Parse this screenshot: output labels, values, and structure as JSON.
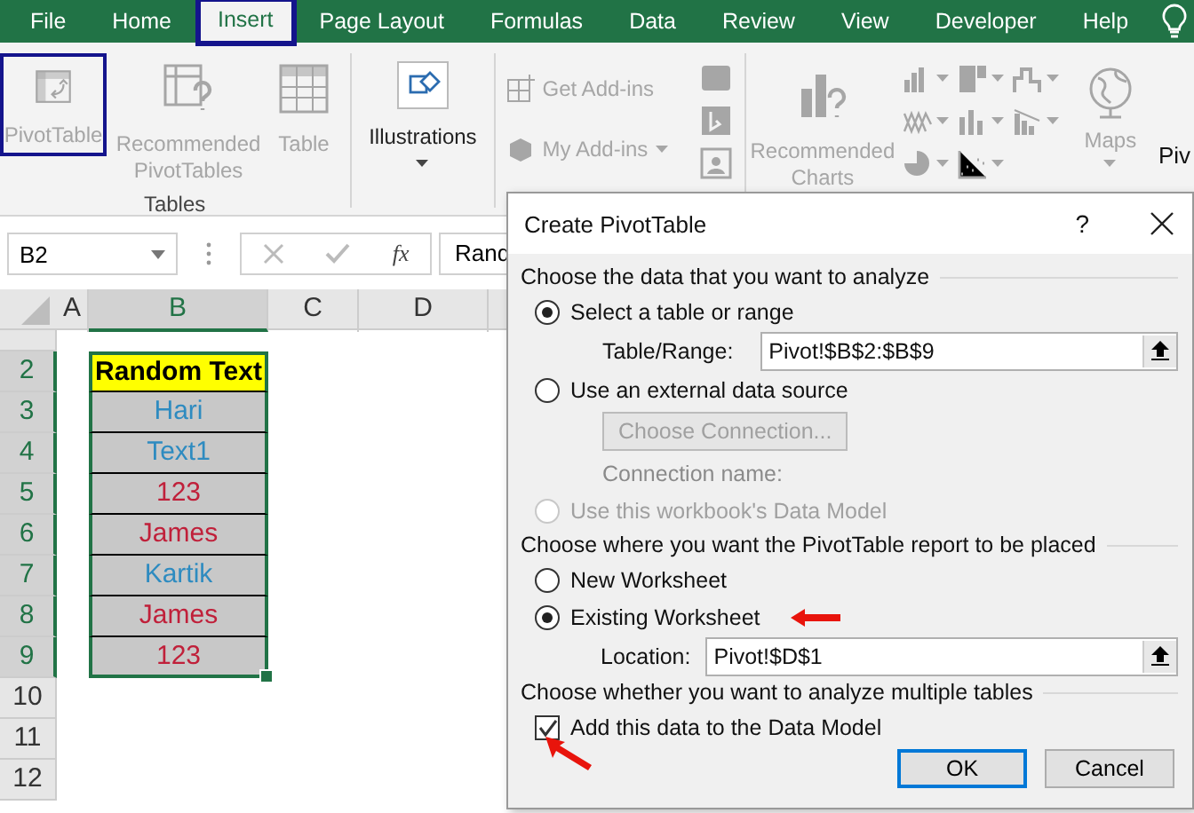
{
  "ribbon_tabs": [
    {
      "label": "File",
      "selected": false,
      "highlighted": false
    },
    {
      "label": "Home",
      "selected": false,
      "highlighted": false
    },
    {
      "label": "Insert",
      "selected": true,
      "highlighted": true
    },
    {
      "label": "Page Layout",
      "selected": false,
      "highlighted": false
    },
    {
      "label": "Formulas",
      "selected": false,
      "highlighted": false
    },
    {
      "label": "Data",
      "selected": false,
      "highlighted": false
    },
    {
      "label": "Review",
      "selected": false,
      "highlighted": false
    },
    {
      "label": "View",
      "selected": false,
      "highlighted": false
    },
    {
      "label": "Developer",
      "selected": false,
      "highlighted": false
    },
    {
      "label": "Help",
      "selected": false,
      "highlighted": false
    }
  ],
  "ribbon": {
    "groups": [
      {
        "label": "Tables",
        "items": [
          {
            "kind": "large",
            "label": "PivotTable",
            "disabled": true,
            "highlighted": true
          },
          {
            "kind": "large",
            "label": "Recommended PivotTables",
            "disabled": true,
            "highlighted": false
          },
          {
            "kind": "large",
            "label": "Table",
            "disabled": true,
            "highlighted": false
          }
        ]
      },
      {
        "items": [
          {
            "kind": "dropdown",
            "label": "Illustrations",
            "disabled": false,
            "highlighted": false
          }
        ]
      },
      {
        "items": [
          {
            "kind": "small",
            "label": "Get Add-ins",
            "disabled": true,
            "highlighted": false
          },
          {
            "kind": "small",
            "label": "My Add-ins",
            "disabled": true,
            "highlighted": false
          },
          {
            "kind": "icons",
            "disabled": true
          }
        ]
      },
      {
        "items": [
          {
            "kind": "large",
            "label": "Recommended Charts",
            "disabled": true,
            "highlighted": false
          },
          {
            "kind": "gallery",
            "disabled": true
          },
          {
            "kind": "dropdown",
            "label": "Maps",
            "disabled": true,
            "highlighted": false
          },
          {
            "kind": "cut",
            "label": "Piv",
            "disabled": false,
            "highlighted": false
          }
        ]
      }
    ]
  },
  "formula_bar": {
    "name_box": "B2",
    "function_label": "fx",
    "formula": "Rand"
  },
  "sheet": {
    "columns": [
      {
        "label": "A",
        "selected": false
      },
      {
        "label": "B",
        "selected": true
      },
      {
        "label": "C",
        "selected": false
      },
      {
        "label": "D",
        "selected": false
      }
    ],
    "rows": [
      {
        "number": "",
        "selected": false,
        "cells": []
      },
      {
        "number": "2",
        "selected": true,
        "cells": [
          {
            "kind": "header",
            "text": "Random Text",
            "selected": true
          }
        ]
      },
      {
        "number": "3",
        "selected": true,
        "cells": [
          {
            "kind": "value",
            "text": "Hari",
            "color": "#2e8bc0",
            "selected": true
          }
        ]
      },
      {
        "number": "4",
        "selected": true,
        "cells": [
          {
            "kind": "value",
            "text": "Text1",
            "color": "#2e8bc0",
            "selected": true
          }
        ]
      },
      {
        "number": "5",
        "selected": true,
        "cells": [
          {
            "kind": "value",
            "text": "123",
            "color": "#c0203a",
            "selected": true
          }
        ]
      },
      {
        "number": "6",
        "selected": true,
        "cells": [
          {
            "kind": "value",
            "text": "James",
            "color": "#c0203a",
            "selected": true
          }
        ]
      },
      {
        "number": "7",
        "selected": true,
        "cells": [
          {
            "kind": "value",
            "text": "Kartik",
            "color": "#2e8bc0",
            "selected": true
          }
        ]
      },
      {
        "number": "8",
        "selected": true,
        "cells": [
          {
            "kind": "value",
            "text": "James",
            "color": "#c0203a",
            "selected": true
          }
        ]
      },
      {
        "number": "9",
        "selected": true,
        "cells": [
          {
            "kind": "value",
            "text": "123",
            "color": "#c0203a",
            "selected": true
          }
        ]
      },
      {
        "number": "10",
        "selected": false,
        "cells": []
      },
      {
        "number": "11",
        "selected": false,
        "cells": []
      },
      {
        "number": "12",
        "selected": false,
        "cells": []
      }
    ]
  },
  "dialog": {
    "title": "Create PivotTable",
    "help": "?",
    "sections": [
      {
        "heading": "Choose the data that you want to analyze",
        "items": [
          {
            "kind": "radio",
            "label": "Select a table or range",
            "selected": true,
            "disabled": false
          },
          {
            "kind": "field",
            "label": "Table/Range:",
            "value": "Pivot!$B$2:$B$9"
          },
          {
            "kind": "radio",
            "label": "Use an external data source",
            "selected": false,
            "disabled": false
          },
          {
            "kind": "button",
            "label": "Choose Connection...",
            "disabled": true
          },
          {
            "kind": "note",
            "label": "Connection name:",
            "disabled": true
          },
          {
            "kind": "radio",
            "label": "Use this workbook's Data Model",
            "selected": false,
            "disabled": true
          }
        ]
      },
      {
        "heading": "Choose where you want the PivotTable report to be placed",
        "items": [
          {
            "kind": "radio",
            "label": "New Worksheet",
            "selected": false,
            "disabled": false
          },
          {
            "kind": "radio",
            "label": "Existing Worksheet",
            "selected": true,
            "disabled": false,
            "annotated": true
          },
          {
            "kind": "field",
            "label": "Location:",
            "value": "Pivot!$D$1"
          }
        ]
      },
      {
        "heading": "Choose whether you want to analyze multiple tables",
        "items": [
          {
            "kind": "checkbox",
            "label": "Add this data to the Data Model",
            "checked": true,
            "annotated": true
          }
        ]
      }
    ],
    "buttons": [
      {
        "label": "OK",
        "default": true
      },
      {
        "label": "Cancel",
        "default": false
      }
    ]
  }
}
